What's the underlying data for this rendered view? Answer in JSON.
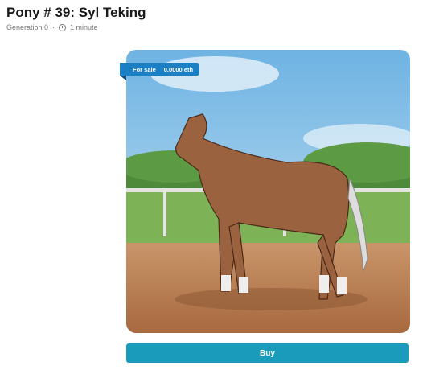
{
  "header": {
    "title": "Pony # 39: Syl Teking",
    "generation": "Generation 0",
    "separator": "·",
    "age": "1 minute"
  },
  "listing": {
    "status": "For sale",
    "price": "0.0000 eth"
  },
  "actions": {
    "buy_label": "Buy"
  },
  "colors": {
    "accent": "#1a9bbc",
    "badge": "#1b7fc4"
  }
}
